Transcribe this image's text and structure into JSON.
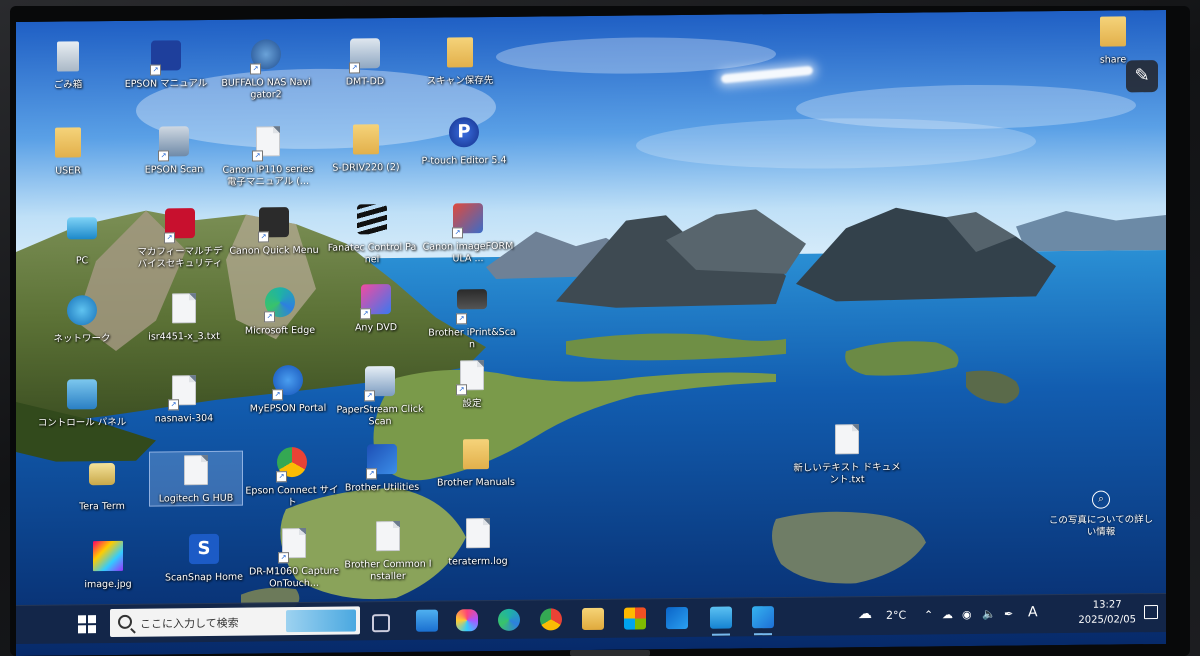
{
  "desktop": {
    "icons": [
      {
        "label": "ごみ箱",
        "icon": "recycle-bin-icon"
      },
      {
        "label": "EPSON マニュアル",
        "icon": "epson-manual-icon"
      },
      {
        "label": "BUFFALO NAS Navigator2",
        "icon": "buffalo-nas-icon"
      },
      {
        "label": "DMT-DD",
        "icon": "dmt-dd-icon"
      },
      {
        "label": "スキャン保存先",
        "icon": "folder-icon"
      },
      {
        "label": "USER",
        "icon": "user-folder-icon"
      },
      {
        "label": "EPSON Scan",
        "icon": "epson-scan-icon"
      },
      {
        "label": "Canon iP110 series 電子マニュアル (...",
        "icon": "canon-manual-icon"
      },
      {
        "label": "S-DRIV220 (2)",
        "icon": "folder-icon"
      },
      {
        "label": "P-touch Editor 5.4",
        "icon": "ptouch-icon"
      },
      {
        "label": "PC",
        "icon": "pc-icon"
      },
      {
        "label": "マカフィーマルチデバイスセキュリティ",
        "icon": "mcafee-icon"
      },
      {
        "label": "Canon Quick Menu",
        "icon": "canon-quick-menu-icon"
      },
      {
        "label": "Fanatec Control Panel",
        "icon": "fanatec-icon"
      },
      {
        "label": "Canon imageFORMULA ...",
        "icon": "canon-imageformula-icon"
      },
      {
        "label": "ネットワーク",
        "icon": "network-icon"
      },
      {
        "label": "isr4451-x_3.txt",
        "icon": "text-file-icon"
      },
      {
        "label": "Microsoft Edge",
        "icon": "edge-icon"
      },
      {
        "label": "Any DVD",
        "icon": "anydvd-icon"
      },
      {
        "label": "Brother iPrint&Scan",
        "icon": "brother-iprint-icon"
      },
      {
        "label": "コントロール パネル",
        "icon": "control-panel-icon"
      },
      {
        "label": "nasnavi-304",
        "icon": "text-file-icon"
      },
      {
        "label": "MyEPSON Portal",
        "icon": "myepson-icon"
      },
      {
        "label": "PaperStream ClickScan",
        "icon": "paperstream-icon"
      },
      {
        "label": "設定",
        "icon": "settings-file-icon"
      },
      {
        "label": "新しいテキスト ドキュメント.txt",
        "icon": "text-file-icon"
      },
      {
        "label": "Tera Term",
        "icon": "teraterm-icon"
      },
      {
        "label": "Logitech G HUB",
        "icon": "text-file-icon"
      },
      {
        "label": "Epson Connect サイト",
        "icon": "chrome-icon"
      },
      {
        "label": "Brother Utilities",
        "icon": "brother-utilities-icon"
      },
      {
        "label": "Brother Manuals",
        "icon": "folder-icon"
      },
      {
        "label": "image.jpg",
        "icon": "image-file-icon"
      },
      {
        "label": "ScanSnap Home",
        "icon": "scansnap-icon"
      },
      {
        "label": "DR-M1060 CaptureOnTouch...",
        "icon": "text-file-icon"
      },
      {
        "label": "Brother Common Installer",
        "icon": "text-file-icon"
      },
      {
        "label": "teraterm.log",
        "icon": "text-file-icon"
      },
      {
        "label": "share",
        "icon": "share-folder-icon"
      }
    ],
    "photo_info_label": "この写真についての詳しい情報"
  },
  "taskbar": {
    "search_placeholder": "ここに入力して検索",
    "weather": "2°C",
    "ime": "A",
    "time": "13:27",
    "date": "2025/02/05",
    "apps": [
      "task-view-icon",
      "mail-icon",
      "copilot-icon",
      "edge-icon",
      "chrome-icon",
      "file-explorer-icon",
      "store-icon",
      "outlook-icon",
      "remote-desktop-icon",
      "photos-icon"
    ]
  },
  "colors": {
    "taskbar": "#142646",
    "sky_top": "#1f63c9",
    "sea": "#0d3f86"
  }
}
